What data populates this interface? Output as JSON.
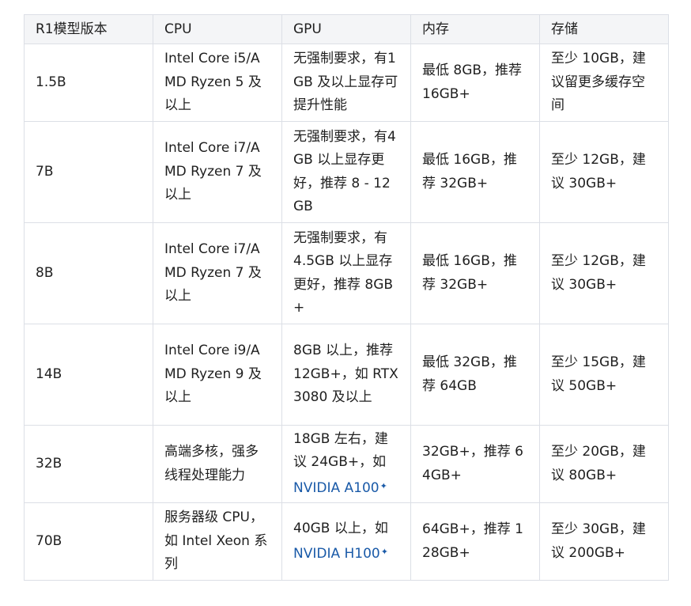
{
  "table": {
    "headers": [
      "R1模型版本",
      "CPU",
      "GPU",
      "内存",
      "存储"
    ],
    "rows": [
      {
        "model": "1.5B",
        "cpu": "Intel Core i5/AMD Ryzen 5 及以上",
        "gpu": "无强制要求，有1GB 及以上显存可提升性能",
        "memory": "最低 8GB，推荐 16GB+",
        "storage": "至少 10GB，建议留更多缓存空间"
      },
      {
        "model": "7B",
        "cpu": "Intel Core i7/AMD Ryzen 7 及以上",
        "gpu": "无强制要求，有4GB 以上显存更好，推荐 8 - 12GB",
        "memory": "最低 16GB，推荐 32GB+",
        "storage": "至少 12GB，建议 30GB+"
      },
      {
        "model": "8B",
        "cpu": "Intel Core i7/AMD Ryzen 7 及以上",
        "gpu": "无强制要求，有4.5GB 以上显存更好，推荐 8GB+",
        "memory": "最低 16GB，推荐 32GB+",
        "storage": "至少 12GB，建议 30GB+"
      },
      {
        "model": "14B",
        "cpu": "Intel Core i9/AMD Ryzen 9 及以上",
        "gpu": "8GB 以上，推荐 12GB+，如 RTX 3080 及以上",
        "memory": "最低 32GB，推荐 64GB",
        "storage": "至少 15GB，建议 50GB+"
      },
      {
        "model": "32B",
        "cpu": "高端多核，强多线程处理能力",
        "gpu_prefix": "18GB 左右，建议 24GB+，如 ",
        "gpu_link": "NVIDIA A100",
        "memory": "32GB+，推荐 64GB+",
        "storage": "至少 20GB，建议 80GB+"
      },
      {
        "model": "70B",
        "cpu": "服务器级 CPU，如 Intel Xeon 系列",
        "gpu_prefix": "40GB 以上，如 ",
        "gpu_link": "NVIDIA H100",
        "memory": "64GB+，推荐 128GB+",
        "storage": "至少 30GB，建议 200GB+"
      }
    ]
  },
  "icons": {
    "link_marker": "sparkle-icon"
  },
  "colors": {
    "link": "#1a5aa8",
    "header_bg": "#f4f5f7",
    "border": "#dcdfe6"
  }
}
